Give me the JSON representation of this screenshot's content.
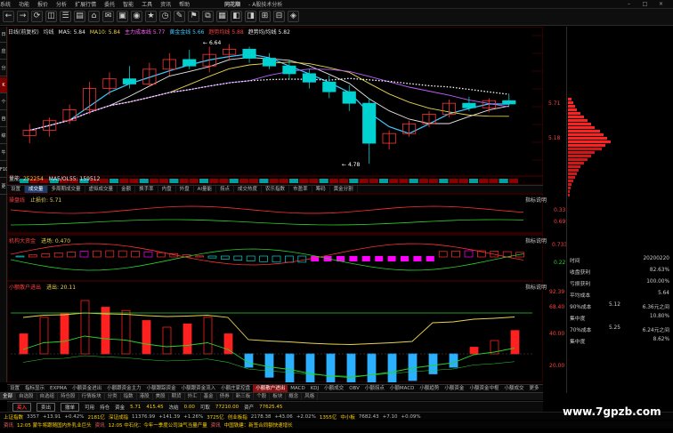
{
  "menu": {
    "items": [
      "系统",
      "功能",
      "报价",
      "分析",
      "扩展行情",
      "委托",
      "智能",
      "工具",
      "资讯",
      "帮助"
    ],
    "brand": "同花顺",
    "subtitle": "- A股技术分析"
  },
  "toolbar": {
    "icons": [
      "←",
      "→",
      "⟳",
      "◫",
      "☰",
      "▤",
      "⌂",
      "✉",
      "▣",
      "◉",
      "★",
      "◷",
      "✎",
      "⚑",
      "⧉",
      "▦",
      "◧",
      "◨",
      "⊞",
      "⊟",
      "◈"
    ]
  },
  "side_tabs": [
    "日线",
    "应用",
    "分时图",
    "K线图",
    "个股资料",
    "自选股",
    "综合排名",
    "牛叉诊股",
    "F10",
    "更多"
  ],
  "chart_header": {
    "period": "日线(前复权)",
    "indicator": "均线",
    "ma5": "MA5: 5.84",
    "ma10": "MA10: 5.84",
    "mid": "主力成本线 5.77",
    "gold": "黄金金线 5.66",
    "gold2": "趋势均线 5.88",
    "trend": "趋势均/均线 5.82"
  },
  "price_labels": {
    "high": "6.64",
    "low": "4.78",
    "p1": "5.71",
    "p2": "5.18"
  },
  "volume_header": {
    "label": "量能",
    "value": "252254",
    "ma": "MA5/OL55: 159512"
  },
  "tabs_mid": [
    "设置",
    "成交量",
    "多周期成交量",
    "虚拟成交量",
    "金额",
    "换手率",
    "内盘",
    "外盘",
    "AI量能",
    "拐点",
    "成交热度",
    "农乐指数",
    "市盈率",
    "筹码",
    "黄金分割"
  ],
  "tabs_mid_active": 1,
  "panel2": {
    "title": "操盘线",
    "sub": "止损价: 5.71",
    "right": "指标说明",
    "v1": "0.33",
    "v2": "0.69",
    "v3": "0.733"
  },
  "panel3": {
    "title": "机构大资金",
    "sub": "进场: 0.470",
    "right": "指标说明",
    "v1": "0.221"
  },
  "panel4": {
    "title": "小额散户进出",
    "sub": "进出: 20.11",
    "right": "指标说明",
    "v1": "92.39",
    "v2": "68.40",
    "v3": "40.00",
    "v4": "20.00"
  },
  "bottom_tabs": [
    "设置",
    "指标显示",
    "EXPMA",
    "小额资金进出",
    "小额跟资金主力",
    "小额跟踪资金",
    "小额跟资金流入",
    "小额庄家控盘",
    "小额散户进出",
    "MACD",
    "KDJ",
    "小额成交",
    "OBV",
    "小额拐点",
    "小额MACD",
    "小额趋势",
    "小额资金",
    "小额资金中枢",
    "小额成交",
    "更多"
  ],
  "bottom_tabs_active": 8,
  "sheet_tabs": [
    "全部",
    "自选股",
    "自选组",
    "持仓股",
    "行情板块",
    "分类",
    "指数",
    "港股",
    "美股",
    "期货",
    "外汇",
    "基金",
    "债券",
    "新三板",
    "个股",
    "板块",
    "概念",
    "风格"
  ],
  "sheet_tabs_active": 0,
  "trade_bar": {
    "items": [
      "买入",
      "卖出",
      "撤单",
      "可用",
      "持仓",
      "资金",
      "5.71",
      "415.45",
      "冻结",
      "0.00",
      "可取",
      "77210.00",
      "资产",
      "77625.45"
    ]
  },
  "tickers_row1": [
    {
      "name": "上证指数",
      "v": "3357",
      "c": "+13.91",
      "pct": "+0.42%",
      "amt": "2181亿"
    },
    {
      "name": "深证成指",
      "v": "11376.99",
      "c": "+141.39",
      "pct": "+1.26%",
      "amt": "3725亿"
    },
    {
      "name": "创业板指",
      "v": "2178.38",
      "c": "+43.06",
      "pct": "+2.02%",
      "amt": "1355亿"
    },
    {
      "name": "中小板",
      "v": "7682.43",
      "c": "+7.10",
      "pct": "+0.09%"
    }
  ],
  "tickers_row2": [
    {
      "name": "资讯",
      "t": "12:05 蒙牛将跟随国内外乳业巨头"
    },
    {
      "name": "资讯",
      "t": "12:05 中石化：今年一季度公司油气当量产量"
    },
    {
      "name": "资讯",
      "t": "中国铁建：新签合同额快速增长"
    }
  ],
  "right_panel": {
    "date_label": "时间",
    "date": "20200220",
    "rows": [
      {
        "k": "收盘获利",
        "v": "82.63%"
      },
      {
        "k": "亏损获利",
        "v": "100.00%"
      },
      {
        "k": "平均成本",
        "v": "5.64"
      },
      {
        "k": "90%成本",
        "m": "5.12",
        "v": "6.36元之间"
      },
      {
        "k": "集中度",
        "v": "10.80%"
      },
      {
        "k": "70%成本",
        "m": "5.25",
        "v": "6.24元之间"
      },
      {
        "k": "集中度",
        "v": "8.62%"
      }
    ]
  },
  "watermark": "www.7gpzb.com",
  "colors": {
    "up": "#ff3535",
    "down": "#00d2d2",
    "ma_yellow": "#e8d44d",
    "ma_white": "#e8e8e8",
    "ma_cyan": "#40c8ff",
    "ma_purple": "#c060ff",
    "dot_line": "#ffffff"
  },
  "chart_data": [
    {
      "type": "candlestick",
      "title": "",
      "candles": [
        {
          "o": 5.22,
          "h": 5.4,
          "l": 5.1,
          "c": 5.3
        },
        {
          "o": 5.3,
          "h": 5.5,
          "l": 5.2,
          "c": 5.45
        },
        {
          "o": 5.45,
          "h": 5.7,
          "l": 5.4,
          "c": 5.62
        },
        {
          "o": 5.62,
          "h": 6.05,
          "l": 5.55,
          "c": 5.95
        },
        {
          "o": 5.95,
          "h": 6.2,
          "l": 5.85,
          "c": 6.1
        },
        {
          "o": 6.1,
          "h": 6.3,
          "l": 5.95,
          "c": 6.02
        },
        {
          "o": 6.02,
          "h": 6.35,
          "l": 5.98,
          "c": 6.25
        },
        {
          "o": 6.25,
          "h": 6.5,
          "l": 6.15,
          "c": 6.4
        },
        {
          "o": 6.4,
          "h": 6.55,
          "l": 6.25,
          "c": 6.3
        },
        {
          "o": 6.3,
          "h": 6.6,
          "l": 6.2,
          "c": 6.48
        },
        {
          "o": 6.48,
          "h": 6.64,
          "l": 6.38,
          "c": 6.56
        },
        {
          "o": 6.56,
          "h": 6.6,
          "l": 6.35,
          "c": 6.42
        },
        {
          "o": 6.42,
          "h": 6.5,
          "l": 6.25,
          "c": 6.3
        },
        {
          "o": 6.3,
          "h": 6.38,
          "l": 6.1,
          "c": 6.18
        },
        {
          "o": 6.18,
          "h": 6.25,
          "l": 5.95,
          "c": 6.05
        },
        {
          "o": 6.05,
          "h": 6.15,
          "l": 5.8,
          "c": 5.9
        },
        {
          "o": 5.9,
          "h": 6.0,
          "l": 5.6,
          "c": 5.72
        },
        {
          "o": 5.72,
          "h": 5.8,
          "l": 4.78,
          "c": 5.1
        },
        {
          "o": 5.1,
          "h": 5.3,
          "l": 5.0,
          "c": 5.25
        },
        {
          "o": 5.25,
          "h": 5.45,
          "l": 5.2,
          "c": 5.4
        },
        {
          "o": 5.4,
          "h": 5.6,
          "l": 5.35,
          "c": 5.55
        },
        {
          "o": 5.55,
          "h": 5.78,
          "l": 5.5,
          "c": 5.72
        },
        {
          "o": 5.72,
          "h": 5.82,
          "l": 5.6,
          "c": 5.65
        },
        {
          "o": 5.65,
          "h": 5.8,
          "l": 5.58,
          "c": 5.76
        },
        {
          "o": 5.76,
          "h": 5.85,
          "l": 5.68,
          "c": 5.71
        }
      ],
      "ylim": [
        4.7,
        6.8
      ]
    },
    {
      "type": "bar",
      "title": "",
      "values": [
        30,
        55,
        60,
        80,
        70,
        65,
        50,
        40,
        45,
        55,
        30,
        -20,
        -35,
        -45,
        -60,
        -70,
        -75,
        -65,
        -55,
        -40,
        -30,
        -20,
        10,
        20,
        35
      ]
    }
  ]
}
